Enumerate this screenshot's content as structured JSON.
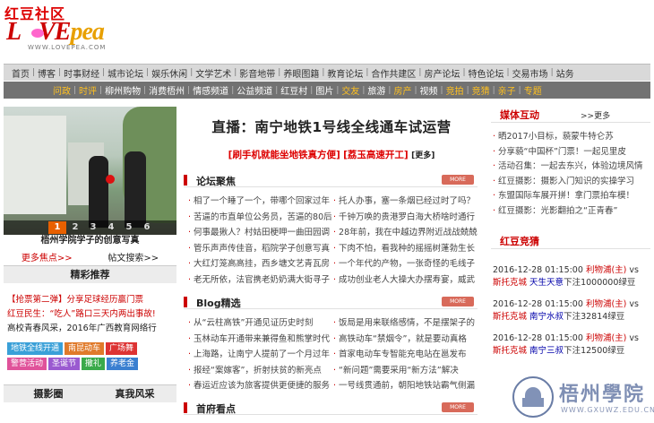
{
  "logo": {
    "cn": "红豆社区",
    "love_a": "L",
    "love_b": "VE",
    "love_c": "pea",
    "url": "WWW.LOVEPEA.COM"
  },
  "nav1": [
    "首页",
    "博客",
    "时事财经",
    "城市论坛",
    "娱乐休闲",
    "文学艺术",
    "影音地带",
    "养眼图籍",
    "教育论坛",
    "合作共建区",
    "房产论坛",
    "特色论坛",
    "交易市场",
    "站务"
  ],
  "nav2": [
    {
      "label": "问政",
      "hl": true
    },
    {
      "label": "时评",
      "hl": true
    },
    {
      "label": "柳州购物",
      "hl": false
    },
    {
      "label": "消费梧州",
      "hl": false
    },
    {
      "label": "情感频道",
      "hl": false
    },
    {
      "label": "公益频道",
      "hl": false
    },
    {
      "label": "红豆村",
      "hl": false
    },
    {
      "label": "图片",
      "hl": false
    },
    {
      "label": "交友",
      "hl": true
    },
    {
      "label": "旅游",
      "hl": false
    },
    {
      "label": "房产",
      "hl": true
    },
    {
      "label": "视频",
      "hl": false
    },
    {
      "label": "竞拍",
      "hl": true
    },
    {
      "label": "竞猜",
      "hl": true
    },
    {
      "label": "亲子",
      "hl": true
    },
    {
      "label": "专题",
      "hl": true
    }
  ],
  "photo": {
    "caption": "梧州学院学子的创意写真",
    "pages": [
      "1",
      "2",
      "3",
      "4",
      "5",
      "6"
    ],
    "active": "1"
  },
  "left": {
    "more_focus": "更多焦点>>",
    "search": "帖文搜索>>",
    "recommend_title": "精彩推荐",
    "recommend": [
      {
        "a": "【抢票第二弹】",
        "b": "分享足球经历赢门票",
        "ac": "#c00",
        "bc": "#c00"
      },
      {
        "a": "红豆民生：",
        "b": "“吃人”路口三天内两出事故!",
        "ac": "#c00",
        "bc": "#c00"
      },
      {
        "a": "高校青春风采，",
        "b": "2016年广西教育网络行",
        "ac": "#222",
        "bc": "#222"
      }
    ],
    "tags": [
      {
        "label": "地铁全线开通",
        "color": "#3aa0d8"
      },
      {
        "label": "南昆动车",
        "color": "#e07a2a"
      },
      {
        "label": "广场舞",
        "color": "#d33"
      },
      {
        "label": "警营活动",
        "color": "#e0529a"
      },
      {
        "label": "圣诞节",
        "color": "#9a5ad0"
      },
      {
        "label": "撒礼",
        "color": "#3aaa4a"
      },
      {
        "label": "养老金",
        "color": "#3a7fd0"
      }
    ],
    "photo_box": "摄影圈",
    "style_box": "真我风采"
  },
  "center": {
    "headline": "直播：南宁地铁1号线全线通车试运营",
    "sub1": "[刷手机就能坐地铁真方便]",
    "sub2": "[荔玉高速开工]",
    "sub_more": "[更多]",
    "forum_title": "论坛聚焦",
    "more_btn": "MORE",
    "forum_left": [
      "相了一个睡了一个，带哪个回家过年",
      "苦逼的市直单位公务员，苦逼的80后",
      "何事最揪人？村姑田梗呷一曲田园调",
      "管乐声声传佳音，稻院学子创意写真",
      "大红灯笼高高挂，西乡塘文艺青瓦房",
      "老无所依，法官携老奶奶满大街寻子"
    ],
    "forum_right": [
      "托人办事，塞一条烟已经过时了吗？",
      "千钟万唤的贵港罗白海大桥啥时通行",
      "28年前，我在中越边界附近战战兢兢",
      "下肉不怕，看我种的摇摇树蓬勃生长",
      "一个年代的产物，一张奇怪的毛线子",
      "成功创业老人大操大办摆寿宴，威武"
    ],
    "blog_title": "Blog精选",
    "blog_left": [
      "从“云柱高铁”开通见证历史时刻",
      "玉林动车开通带来兼得鱼和熊掌时代",
      "上海路，让南宁人提前了一个月过年",
      "报经“案嫁客”，折射扶贫的新亮点",
      "春运近应该为旅客提供更便捷的服务"
    ],
    "blog_right": [
      "饭局是用来联络感情，不是摆架子的",
      "高铁动车“禁烟令”，就是要动真格",
      "首家电动车专智能充电站在邕发布",
      "“新问题”需要采用“新方法”解决",
      "一号线贯通前，朝阳地铁站霸气侧漏"
    ],
    "sports_title": "首府看点"
  },
  "right": {
    "media_title": "媒体互动",
    "media_more": ">>更多",
    "media": [
      "晒2017小目标，藐蒙牛特仑苏",
      "分享藐“中国杯”门票！一起见里皮",
      "活动召集：一起去东兴，体验边境风情",
      "红豆摄影：摄影入门知识的实操学习",
      "东盟国际车展开拼！拿门票拍车模！",
      "红豆摄影：光影翻拍之“正青春”"
    ],
    "quiz_title": "红豆竞猜",
    "matches": [
      {
        "time": "2016-12-28 01:15:00",
        "t1": "利物浦(主)",
        "vs": "vs",
        "t2": "斯托克城",
        "bet": "天生天意",
        "rest": "下注1000000绿豆"
      },
      {
        "time": "2016-12-28 01:15:00",
        "t1": "利物浦(主)",
        "vs": "vs",
        "t2": "斯托克城",
        "bet": "南宁水叔",
        "rest": "下注32814绿豆"
      },
      {
        "time": "2016-12-28 01:15:00",
        "t1": "利物浦(主)",
        "vs": "vs",
        "t2": "斯托克城",
        "bet": "南宁三叔",
        "rest": "下注12500绿豆"
      }
    ]
  },
  "watermark": {
    "name": "梧州學院",
    "url": "WWW.GXUWZ.EDU.CN"
  }
}
